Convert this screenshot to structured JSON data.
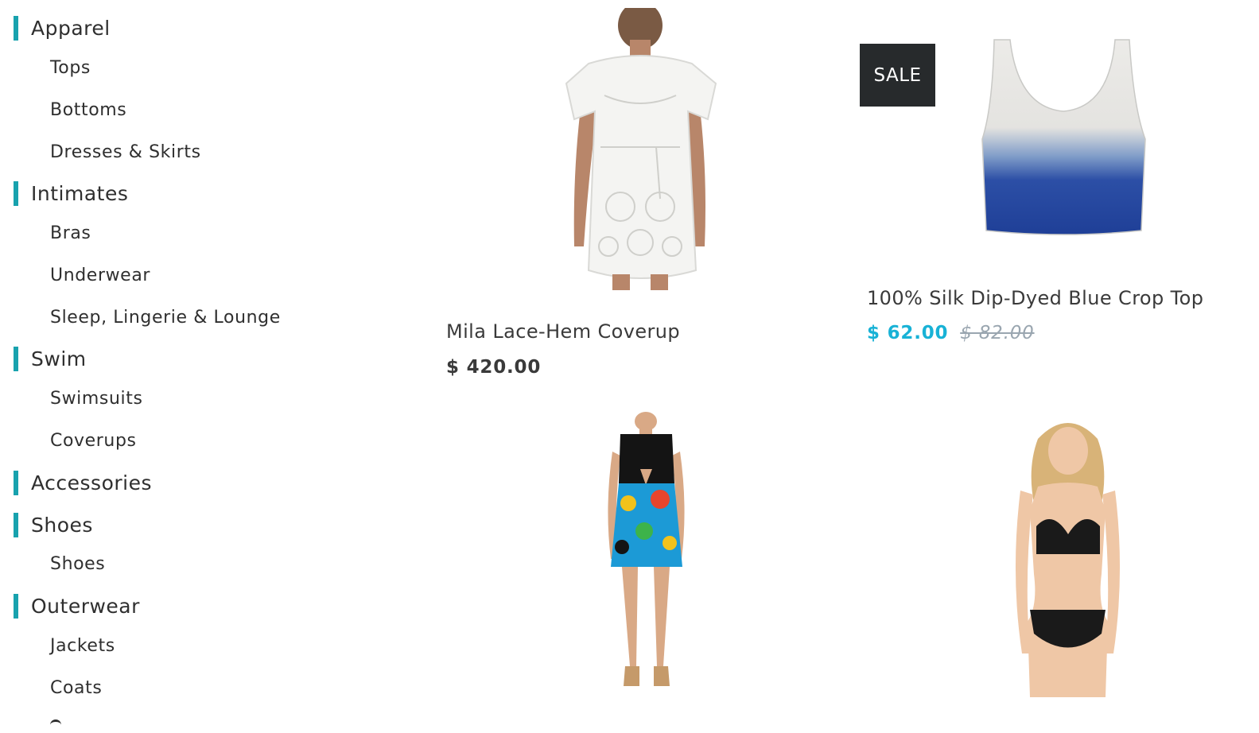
{
  "sidebar": {
    "categories": [
      {
        "label": "Apparel",
        "items": [
          "Tops",
          "Bottoms",
          "Dresses & Skirts"
        ]
      },
      {
        "label": "Intimates",
        "items": [
          "Bras",
          "Underwear",
          "Sleep, Lingerie & Lounge"
        ]
      },
      {
        "label": "Swim",
        "items": [
          "Swimsuits",
          "Coverups"
        ]
      },
      {
        "label": "Accessories",
        "items": []
      },
      {
        "label": "Shoes",
        "items": [
          "Shoes"
        ]
      },
      {
        "label": "Outerwear",
        "items": [
          "Jackets",
          "Coats"
        ]
      }
    ],
    "accent_color": "#18a2ae"
  },
  "products": [
    {
      "title": "Mila Lace-Hem Coverup",
      "price": "$ 420.00",
      "image": "lace-coverup-image"
    },
    {
      "title": "100% Silk Dip-Dyed Blue Crop Top",
      "sale_price": "$ 62.00",
      "original_price": "$ 82.00",
      "badge": "SALE",
      "image": "crop-top-image"
    },
    {
      "image": "floral-romper-image"
    },
    {
      "image": "black-bikini-image"
    }
  ],
  "colors": {
    "sale": "#18b2d6",
    "badge_bg": "#272a2c"
  }
}
